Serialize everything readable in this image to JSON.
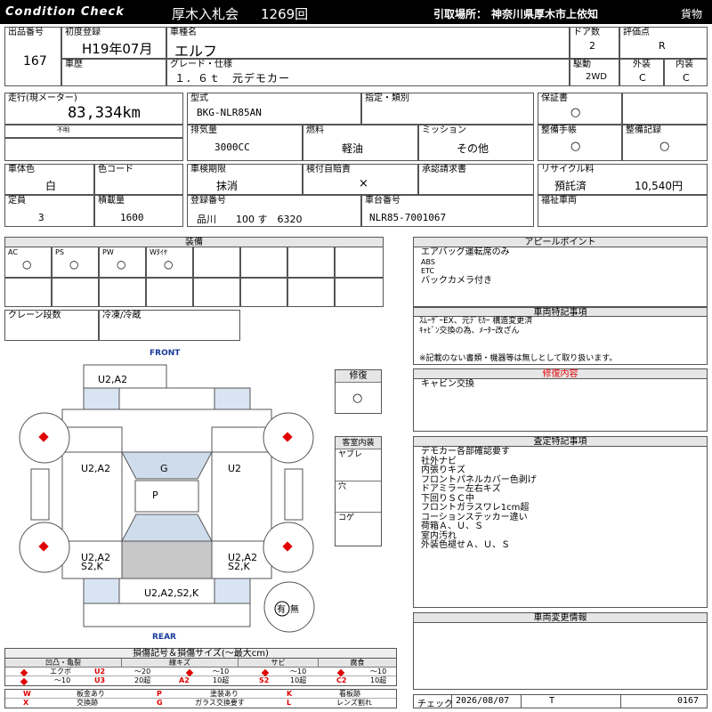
{
  "header": {
    "brand": "Condition  Check",
    "auction_name": "厚木入札会",
    "auction_number": "1269回",
    "pickup_label": "引取場所：",
    "pickup_location": "神奈川県厚木市上依知",
    "category": "貨物"
  },
  "row1": {
    "lot_label": "出品番号",
    "lot_value": "167",
    "first_reg_label": "初度登録",
    "first_reg_value": "H19年07月",
    "car_name_label": "車種名",
    "car_name_value": "エルフ",
    "doors_label": "ドア数",
    "doors_value": "2",
    "score_label": "評価点",
    "score_value": "R",
    "history_label": "車歴",
    "grade_label": "グレード・仕様",
    "grade_value": "１．６ｔ　元デモカー",
    "drive_label": "駆動",
    "drive_value": "2WD",
    "exterior_label": "外装",
    "exterior_value": "C",
    "interior_label": "内装",
    "interior_value": "C"
  },
  "row2": {
    "mileage_label": "走行(現メーター)",
    "mileage_value": "83,334km",
    "mileage_note": "不明",
    "model_label": "型式",
    "model_value": "BKG-NLR85AN",
    "designation_label": "指定・類別",
    "warranty_label": "保証書",
    "warranty_value": "○",
    "displacement_label": "排気量",
    "displacement_value": "3000CC",
    "fuel_label": "燃料",
    "fuel_value": "軽油",
    "mission_label": "ミッション",
    "mission_value": "その他",
    "maint_book_label": "整備手帳",
    "maint_book_value": "○",
    "maint_record_label": "整備記録",
    "maint_record_value": "○"
  },
  "row3": {
    "body_color_label": "車体色",
    "body_color_value": "白",
    "color_code_label": "色コード",
    "inspection_label": "車検期限",
    "inspection_value": "抹消",
    "insurance_label": "検付自賠責",
    "insurance_value": "×",
    "approval_label": "承認請求書",
    "recycle_label": "リサイクル料",
    "recycle_status": "預託済",
    "recycle_amount": "10,540円",
    "capacity_label": "定員",
    "capacity_value": "3",
    "load_label": "積載量",
    "load_value": "1600",
    "reg_no_label": "登録番号",
    "reg_no_value": "品川　　100 す　6320",
    "chassis_label": "車台番号",
    "chassis_value": "NLR85-7001067",
    "welfare_label": "福祉車両"
  },
  "equipment": {
    "title": "装備",
    "items": [
      {
        "label": "AC",
        "value": "○"
      },
      {
        "label": "PS",
        "value": "○"
      },
      {
        "label": "PW",
        "value": "○"
      },
      {
        "label": "Wﾀｲﾔ",
        "value": "○"
      }
    ],
    "crane_label": "クレーン段数",
    "freezer_label": "冷凍/冷蔵"
  },
  "appeal": {
    "title": "アピールポイント",
    "lines": [
      "エアバッグ運転席のみ",
      "ABS",
      "ETC",
      "バックカメラ付き"
    ]
  },
  "special_notes": {
    "title": "車両特記事項",
    "lines": [
      "ｽﾑｰｻﾞｰEX、元ﾃﾞﾓｶｰ 構造変更済",
      "ｷｬﾋﾞﾝ交換の為、ﾒｰﾀｰ改ざん"
    ],
    "disclaimer": "※記載のない書類・機器等は無しとして取り扱います。"
  },
  "repair": {
    "label": "修復",
    "value": "○",
    "title": "修復内容",
    "lines": [
      "キャビン交換"
    ],
    "accent": "#e00000"
  },
  "inspection_notes": {
    "title": "査定特記事項",
    "lines": [
      "デモカー各部確認要す",
      "社外ナビ",
      "内張りキズ",
      "フロントパネルカバー色剥げ",
      "ドアミラー左右キズ",
      "下回りＳＣ中",
      "フロントガラスワレ1cm超",
      "コーションステッカー違い",
      "荷箱Ａ、Ｕ、Ｓ",
      "室内汚れ",
      "外装色褪せＡ、Ｕ、Ｓ"
    ]
  },
  "change_info": {
    "title": "車両変更情報"
  },
  "cabin": {
    "title": "客室内装",
    "items": [
      "ヤブレ",
      "穴",
      "コゲ"
    ]
  },
  "diagram": {
    "front": "FRONT",
    "rear": "REAR",
    "marks": {
      "top": "U2,A2",
      "left_front": "U2,A2",
      "windshield": "G",
      "right_front": "U2",
      "seat": "P",
      "left_rear_1": "U2,A2",
      "left_rear_2": "S2,K",
      "right_rear_1": "U2,A2",
      "right_rear_2": "S2,K",
      "rear": "U2,A2,S2,K"
    },
    "spare_tire_have": "有",
    "spare_tire_none": "無"
  },
  "legend": {
    "title": "損傷記号＆損傷サイズ(～最大cm)",
    "groups": [
      {
        "name": "凹凸・亀裂",
        "cols": [
          [
            "エクボ",
            "U2",
            "～20"
          ],
          [
            "U",
            "U3",
            "20超"
          ]
        ]
      },
      {
        "name": "線キズ",
        "cols": [
          [
            "A",
            "～10"
          ],
          [
            "A2",
            "10超"
          ]
        ]
      },
      {
        "name": "サビ",
        "cols": [
          [
            "S",
            "～10"
          ],
          [
            "S2",
            "10超"
          ]
        ]
      },
      {
        "name": "腐食",
        "cols": [
          [
            "C",
            "～10"
          ],
          [
            "C2",
            "10超"
          ]
        ]
      }
    ],
    "row_a": [
      {
        "code": "W",
        "text": "板金あり"
      },
      {
        "code": "P",
        "text": "塗装あり"
      },
      {
        "code": "K",
        "text": "看板跡"
      }
    ],
    "row_b": [
      {
        "code": "X",
        "text": "交換跡"
      },
      {
        "code": "G",
        "text": "ガラス交換要す"
      },
      {
        "code": "L",
        "text": "レンズ割れ"
      }
    ]
  },
  "footer": {
    "check_label": "チェック",
    "date": "2026/08/07",
    "inspector": "T",
    "number": "0167"
  }
}
